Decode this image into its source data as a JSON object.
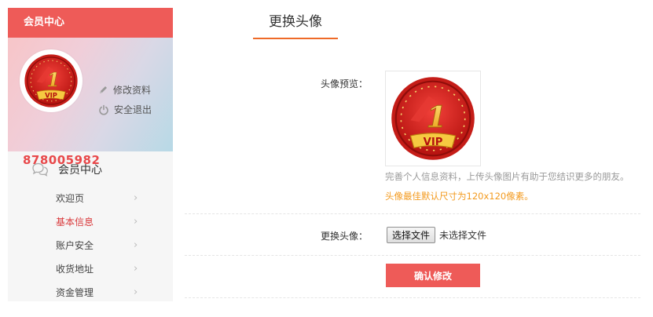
{
  "sidebar": {
    "header_title": "会员中心",
    "profile": {
      "edit_label": "修改资料",
      "logout_label": "安全退出",
      "username": "878005982",
      "badge_text": "VIP",
      "badge_number": "1"
    },
    "nav_title": "会员中心",
    "items": [
      {
        "label": "欢迎页"
      },
      {
        "label": "基本信息"
      },
      {
        "label": "账户安全"
      },
      {
        "label": "收货地址"
      },
      {
        "label": "资金管理"
      }
    ]
  },
  "main": {
    "tab_label": "更换头像",
    "preview_label": "头像预览：",
    "hint_text": "完善个人信息资料，上传头像图片有助于您结识更多的朋友。",
    "size_hint": "头像最佳默认尺寸为120x120像素。",
    "change_label": "更换头像：",
    "file_button_label": "选择文件",
    "file_status": "未选择文件",
    "submit_label": "确认修改"
  },
  "colors": {
    "brand_red": "#ee5b58",
    "active_nav": "#d9383a",
    "tab_underline": "#ee6a28",
    "size_hint_orange": "#f39a1e"
  },
  "icons": [
    "pencil-icon",
    "power-icon",
    "chat-bubbles-icon",
    "chevron-right-icon"
  ]
}
